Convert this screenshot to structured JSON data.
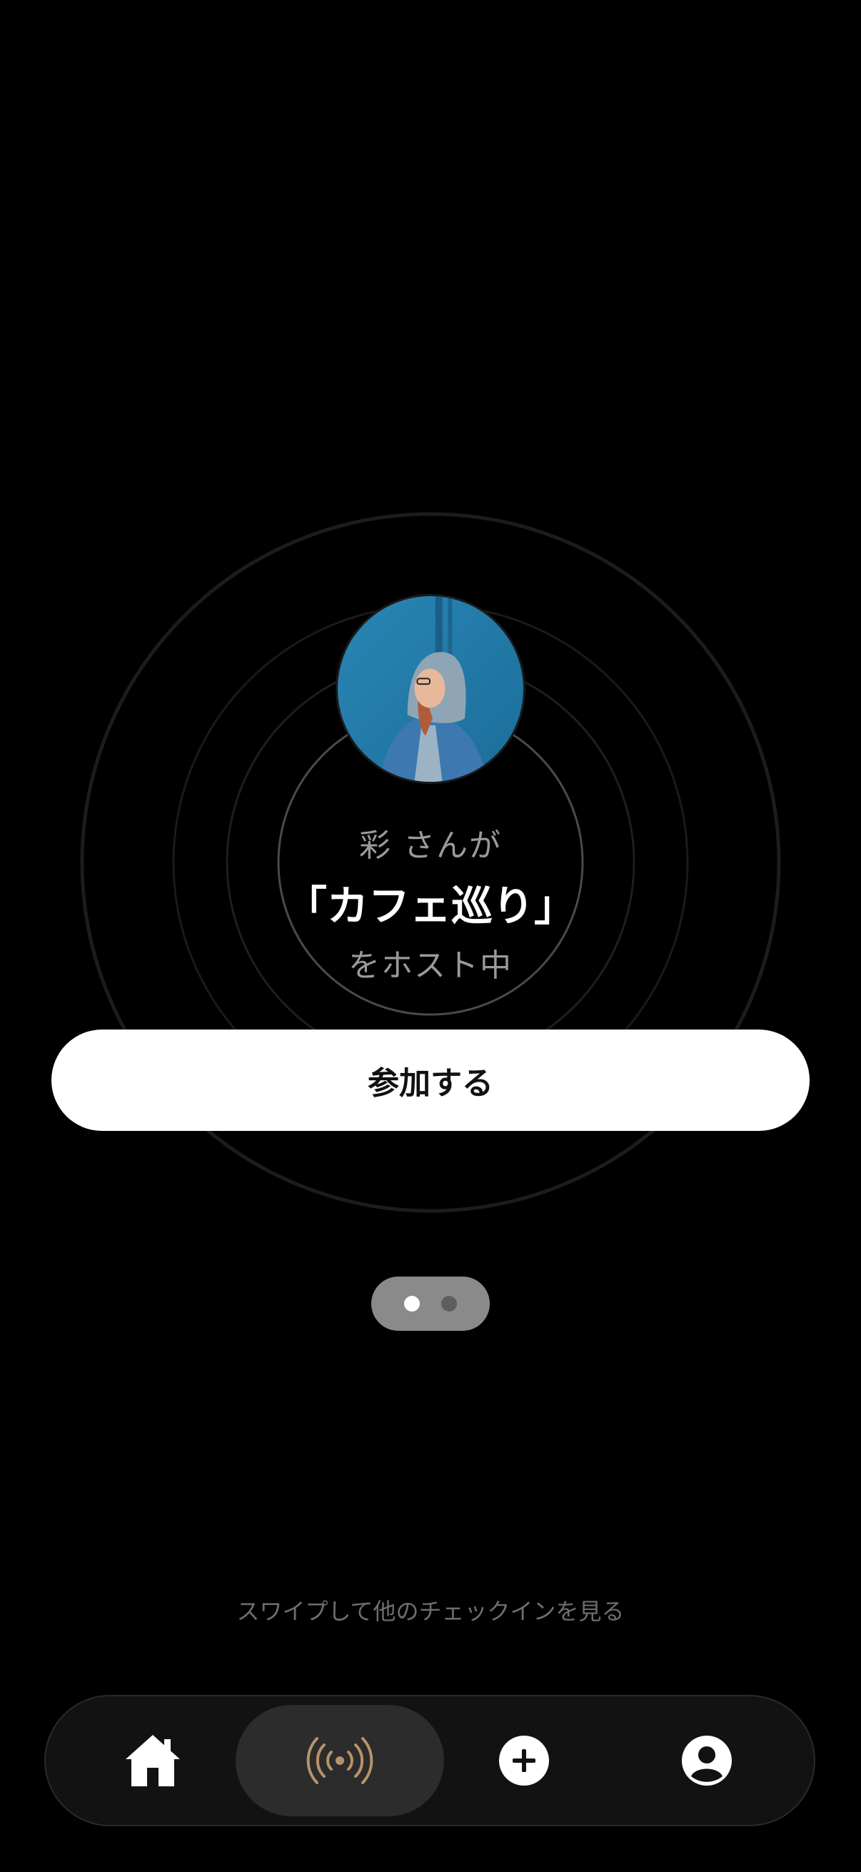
{
  "host_card": {
    "line1": "彩 さんが",
    "title": "「カフェ巡り」",
    "line3": "をホスト中",
    "avatar_alt": "host-avatar-photo"
  },
  "join_button": {
    "label": "参加する"
  },
  "pager": {
    "total": 2,
    "current": 1
  },
  "swipe_hint": "スワイプして他のチェックインを見る",
  "tab_bar": {
    "items": [
      {
        "icon": "home-icon",
        "selected": false
      },
      {
        "icon": "broadcast-icon",
        "selected": true
      },
      {
        "icon": "plus-circle-icon",
        "selected": false
      },
      {
        "icon": "profile-icon",
        "selected": false
      }
    ],
    "accent_color": "#b8936a"
  },
  "colors": {
    "background": "#000000",
    "button_bg": "#ffffff",
    "muted_text": "#9a9a9a",
    "hint_text": "#6e6e6e"
  }
}
